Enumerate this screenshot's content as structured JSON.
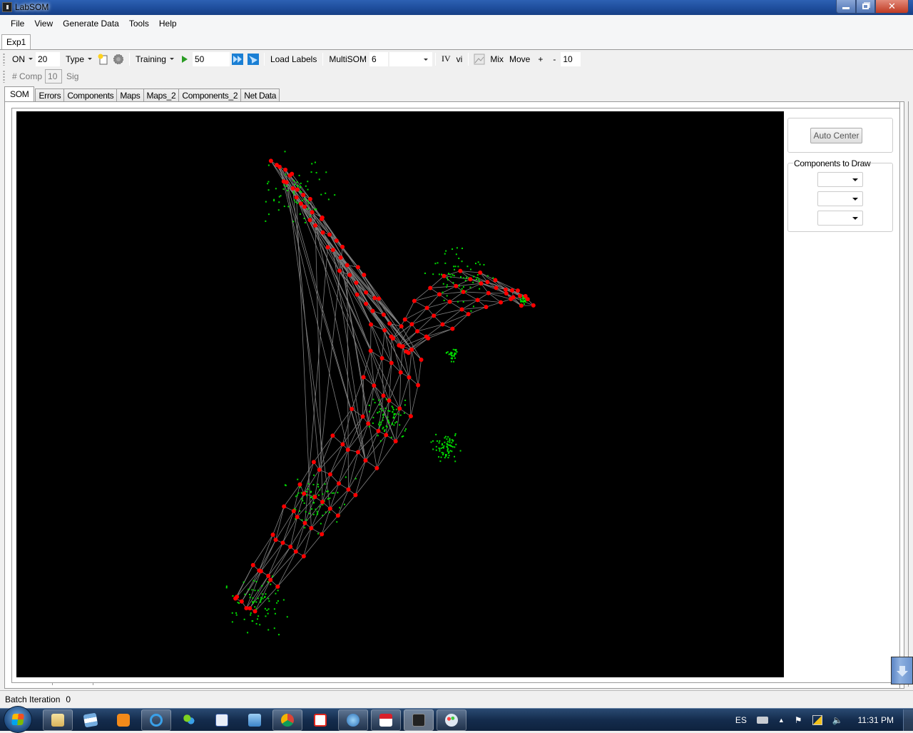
{
  "window": {
    "title": "LabSOM",
    "controls": {
      "minimize": "—",
      "maximize": "❐",
      "close": "✕"
    }
  },
  "menu": [
    "File",
    "View",
    "Generate Data",
    "Tools",
    "Help"
  ],
  "document_tab": "Exp1",
  "toolbar": {
    "on_dropdown": "ON",
    "on_value": "20",
    "type_dropdown": "Type",
    "new_icon": "new-document-icon",
    "settings_icon": "gear-icon",
    "training_dropdown": "Training",
    "play_icon": "play-icon",
    "iterations_value": "50",
    "fast_forward_icon": "fast-forward-icon",
    "step_icon": "step-icon",
    "load_labels": "Load Labels",
    "multisom_label": "MultiSOM",
    "multisom_value": "6",
    "multisom_select": "",
    "iv_button": "IV",
    "vi_button": "vi",
    "image_icon": "image-icon",
    "mix_button": "Mix",
    "move_button": "Move",
    "plus_button": "+",
    "minus_button": "-",
    "step_value": "10"
  },
  "toolbar2": {
    "comp_label": "# Comp",
    "comp_value": "10",
    "sig_label": "Sig"
  },
  "tabs": [
    {
      "label": "SOM",
      "active": true
    },
    {
      "label": "Errors",
      "active": false
    },
    {
      "label": "Components",
      "active": false
    },
    {
      "label": "Maps",
      "active": false
    },
    {
      "label": "Maps_2",
      "active": false
    },
    {
      "label": "Components_2",
      "active": false
    },
    {
      "label": "Net Data",
      "active": false
    }
  ],
  "side_panel": {
    "auto_center": "Auto Center",
    "components_group": "Components to Draw",
    "component_selects": [
      "",
      "",
      ""
    ]
  },
  "visualization": {
    "background": "#000000",
    "neuron_color": "#ff0000",
    "data_point_color": "#00dd00",
    "edge_color": "#808080",
    "highlight_color": "#0000ff"
  },
  "status": {
    "label": "Batch Iteration",
    "value": "0"
  },
  "taskbar": {
    "apps": [
      "file-explorer",
      "flag-app",
      "media-player",
      "internet-explorer",
      "messenger",
      "word",
      "remote-desktop",
      "chrome",
      "acrobat",
      "itunes",
      "notes",
      "labsom",
      "paint"
    ],
    "language": "ES",
    "clock": "11:31 PM"
  }
}
